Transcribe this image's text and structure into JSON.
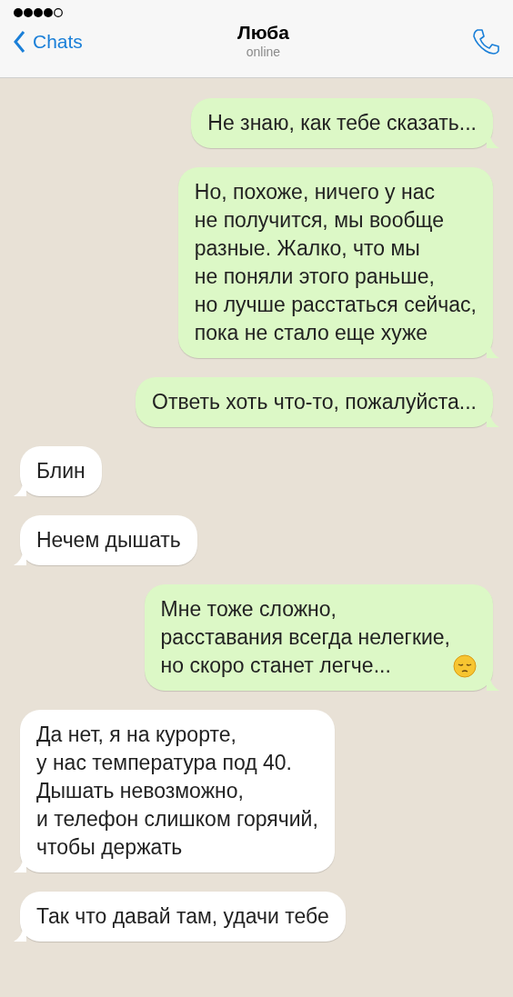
{
  "header": {
    "back_label": "Chats",
    "contact_name": "Люба",
    "status": "online"
  },
  "messages": [
    {
      "kind": "outgoing",
      "emoji": false,
      "text": "Не знаю, как тебе сказать..."
    },
    {
      "kind": "outgoing",
      "emoji": false,
      "text": "Но, похоже, ничего у нас\nне получится, мы вообще\nразные. Жалко, что мы\nне поняли этого раньше,\nно лучше расстаться сейчас,\nпока не стало еще хуже"
    },
    {
      "kind": "outgoing",
      "emoji": false,
      "text": "Ответь хоть что-то, пожалуйста..."
    },
    {
      "kind": "incoming",
      "emoji": false,
      "text": "Блин"
    },
    {
      "kind": "incoming",
      "emoji": false,
      "text": "Нечем дышать"
    },
    {
      "kind": "outgoing",
      "emoji": true,
      "text": "Мне тоже сложно,\nрасставания всегда нелегкие,\nно скоро станет легче..."
    },
    {
      "kind": "incoming",
      "emoji": false,
      "text": "Да нет, я на курорте,\nу нас температура под 40.\nДышать невозможно,\nи телефон слишком горячий,\nчтобы держать"
    },
    {
      "kind": "incoming",
      "emoji": false,
      "text": "Так что давай там, удачи тебе"
    }
  ]
}
